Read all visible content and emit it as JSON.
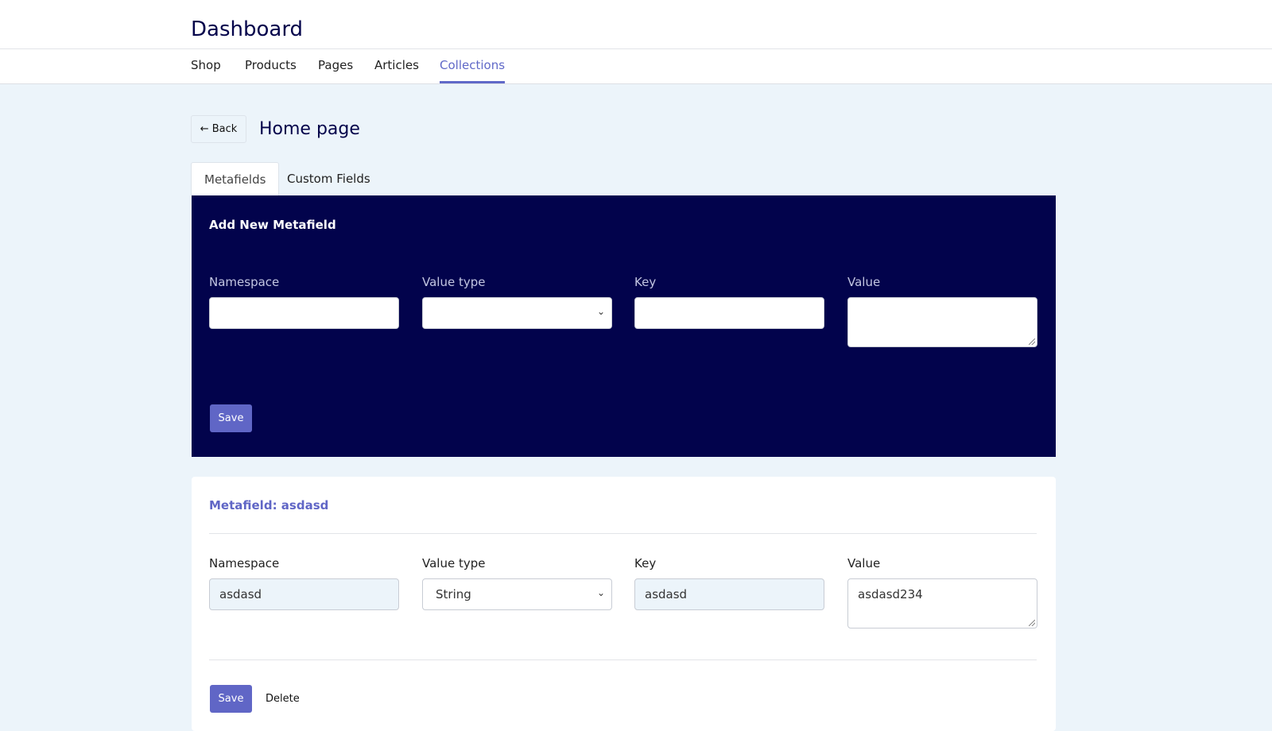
{
  "header": {
    "title": "Dashboard"
  },
  "nav": {
    "items": [
      {
        "label": "Shop"
      },
      {
        "label": "Products"
      },
      {
        "label": "Pages"
      },
      {
        "label": "Articles"
      },
      {
        "label": "Collections",
        "active": true
      }
    ]
  },
  "page": {
    "back_label": "← Back",
    "title": "Home page"
  },
  "tabs": [
    {
      "label": "Metafields",
      "active": true
    },
    {
      "label": "Custom Fields"
    }
  ],
  "new_form": {
    "heading": "Add New Metafield",
    "namespace_label": "Namespace",
    "value_type_label": "Value type",
    "key_label": "Key",
    "value_label": "Value",
    "namespace_value": "",
    "value_type_value": "",
    "key_value": "",
    "value_value": "",
    "save_label": "Save"
  },
  "existing": {
    "heading": "Metafield: asdasd",
    "namespace_label": "Namespace",
    "value_type_label": "Value type",
    "key_label": "Key",
    "value_label": "Value",
    "namespace_value": "asdasd",
    "value_type_value": "String",
    "key_value": "asdasd",
    "value_value": "asdasd234",
    "save_label": "Save",
    "delete_label": "Delete"
  },
  "colors": {
    "accent": "#6066c6",
    "dark_panel": "#02034c",
    "background": "#ecf4fa"
  }
}
